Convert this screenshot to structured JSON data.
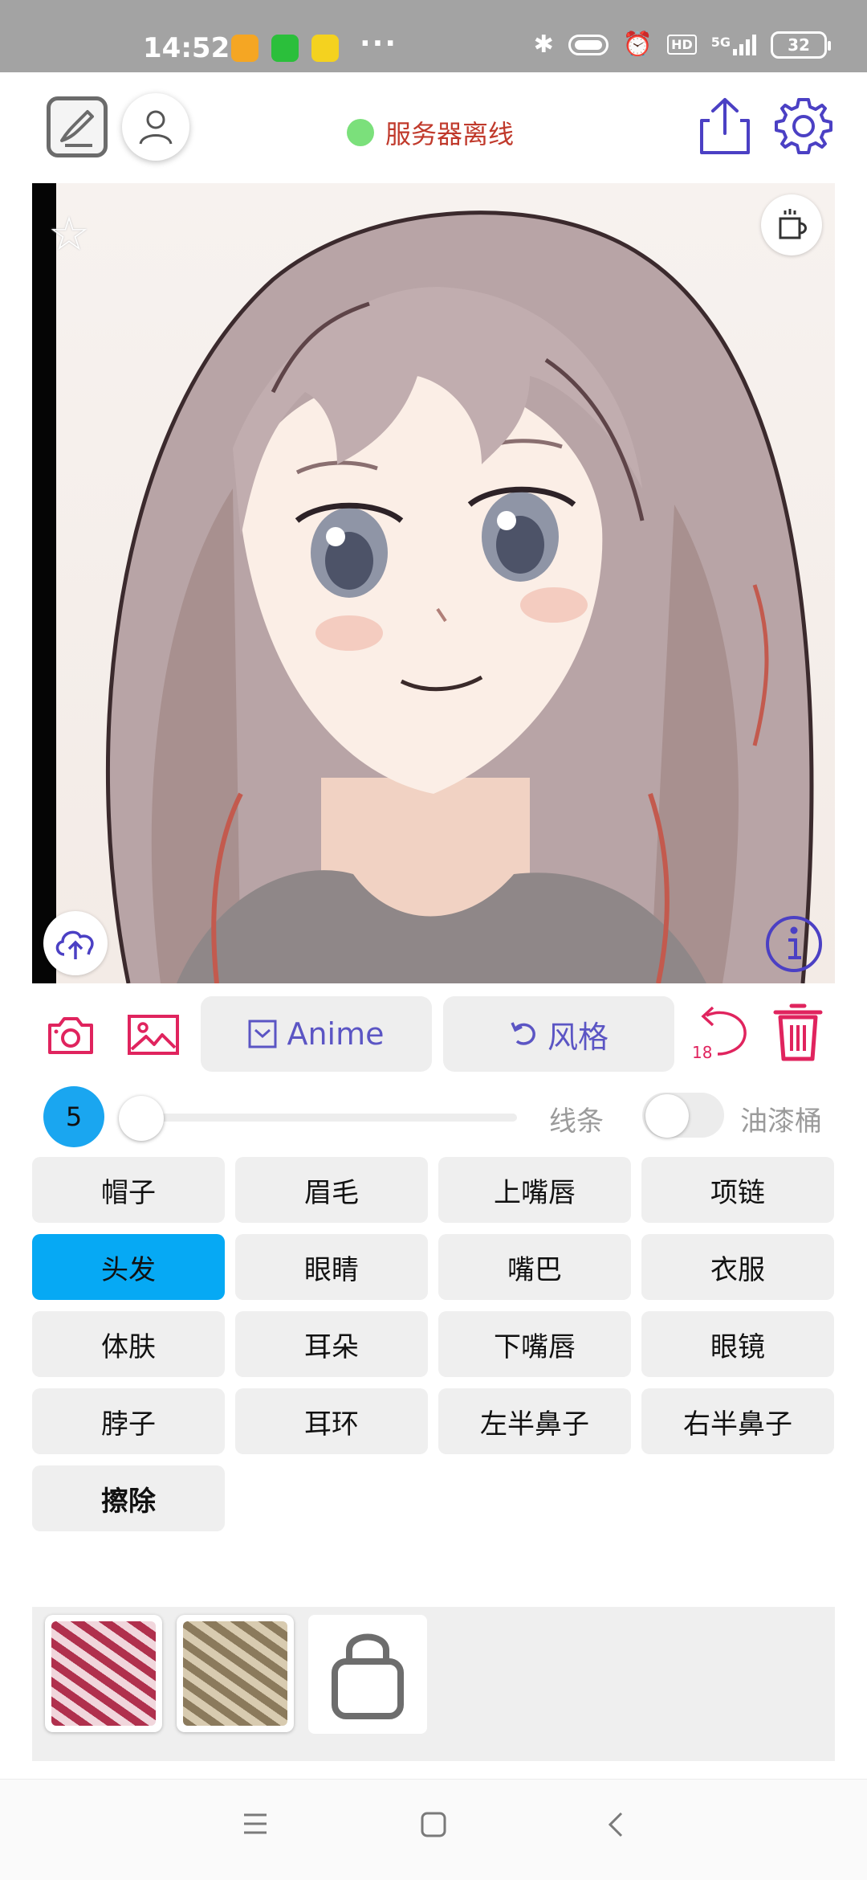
{
  "status_bar": {
    "time": "14:52",
    "dots": "···",
    "battery": "32",
    "network": "5G",
    "hd": "HD",
    "app_icons": [
      {
        "name": "notes-app-icon",
        "color": "#f5a623"
      },
      {
        "name": "iqiyi-app-icon",
        "color": "#2bbf3b"
      },
      {
        "name": "music-app-icon",
        "color": "#f4d21f"
      }
    ]
  },
  "toolbar": {
    "server_status": "服务器离线",
    "server_status_color": "#c0392b",
    "status_dot_color": "#7be07b",
    "icon_color": "#4b40c4"
  },
  "actions": {
    "anime_label": "Anime",
    "style_label": "风格",
    "undo_count": "18",
    "accent_red": "#e0245e",
    "accent_purple": "#5b55c4"
  },
  "slider": {
    "brush_size": "5",
    "value_fraction": 0.0,
    "line_label": "线条",
    "bucket_label": "油漆桶",
    "bucket_enabled": false
  },
  "parts": [
    {
      "label": "帽子",
      "active": false
    },
    {
      "label": "眉毛",
      "active": false
    },
    {
      "label": "上嘴唇",
      "active": false
    },
    {
      "label": "项链",
      "active": false
    },
    {
      "label": "头发",
      "active": true
    },
    {
      "label": "眼睛",
      "active": false
    },
    {
      "label": "嘴巴",
      "active": false
    },
    {
      "label": "衣服",
      "active": false
    },
    {
      "label": "体肤",
      "active": false
    },
    {
      "label": "耳朵",
      "active": false
    },
    {
      "label": "下嘴唇",
      "active": false
    },
    {
      "label": "眼镜",
      "active": false
    },
    {
      "label": "脖子",
      "active": false
    },
    {
      "label": "耳环",
      "active": false
    },
    {
      "label": "左半鼻子",
      "active": false
    },
    {
      "label": "右半鼻子",
      "active": false
    },
    {
      "label": "擦除",
      "active": false
    }
  ],
  "palette": {
    "swatches": [
      {
        "name": "crimson-texture",
        "colors": [
          "#b0304d",
          "#f1d6dc"
        ]
      },
      {
        "name": "sand-texture",
        "colors": [
          "#8b7a5c",
          "#d8cbb0"
        ]
      }
    ],
    "store_icon": "shopping-bag-icon"
  }
}
